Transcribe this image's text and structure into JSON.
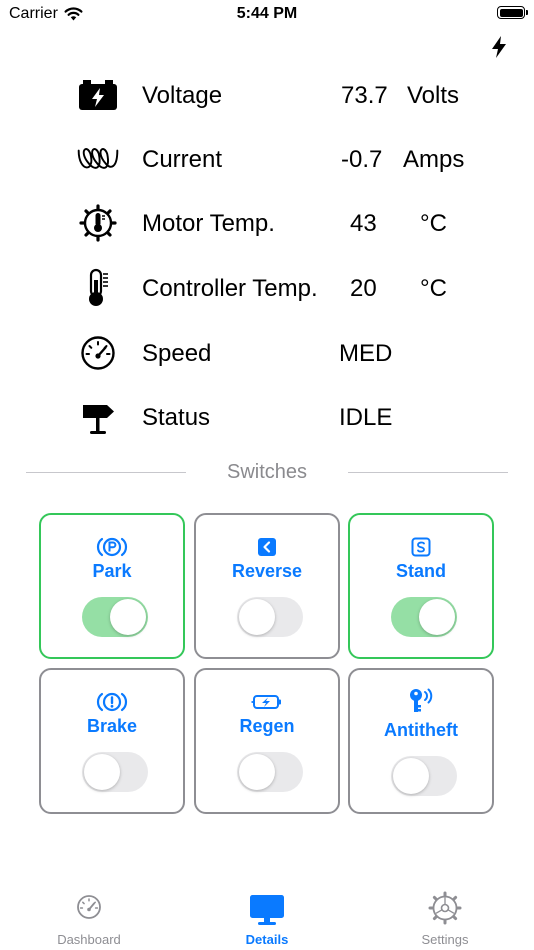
{
  "status_bar": {
    "carrier": "Carrier",
    "time": "5:44 PM"
  },
  "metrics": [
    {
      "icon": "battery-bolt-icon",
      "label": "Voltage",
      "value": "73.7",
      "unit": "Volts"
    },
    {
      "icon": "coil-icon",
      "label": "Current",
      "value": "-0.7",
      "unit": "Amps"
    },
    {
      "icon": "gear-thermometer-icon",
      "label": "Motor Temp.",
      "value": "43",
      "unit": "°C"
    },
    {
      "icon": "thermometer-icon",
      "label": "Controller Temp.",
      "value": "20",
      "unit": "°C"
    },
    {
      "icon": "gauge-icon",
      "label": "Speed",
      "value": "MED",
      "unit": ""
    },
    {
      "icon": "signpost-icon",
      "label": "Status",
      "value": "IDLE",
      "unit": ""
    }
  ],
  "switches": {
    "heading": "Switches",
    "items": [
      {
        "label": "Park",
        "icon": "parking-brake-icon",
        "on": true
      },
      {
        "label": "Reverse",
        "icon": "chevron-left-square-icon",
        "on": false
      },
      {
        "label": "Stand",
        "icon": "s-square-icon",
        "on": true
      },
      {
        "label": "Brake",
        "icon": "brake-warning-icon",
        "on": false
      },
      {
        "label": "Regen",
        "icon": "battery-charging-icon",
        "on": false
      },
      {
        "label": "Antitheft",
        "icon": "key-signal-icon",
        "on": false
      }
    ]
  },
  "tabs": [
    {
      "label": "Dashboard",
      "icon": "speedometer-icon",
      "active": false
    },
    {
      "label": "Details",
      "icon": "monitor-icon",
      "active": true
    },
    {
      "label": "Settings",
      "icon": "gear-icon",
      "active": false
    }
  ],
  "colors": {
    "accent": "#0a7aff",
    "switch_on_border": "#34c759",
    "switch_on_track": "#95dfa5",
    "switch_off_border": "#8e8e93"
  }
}
